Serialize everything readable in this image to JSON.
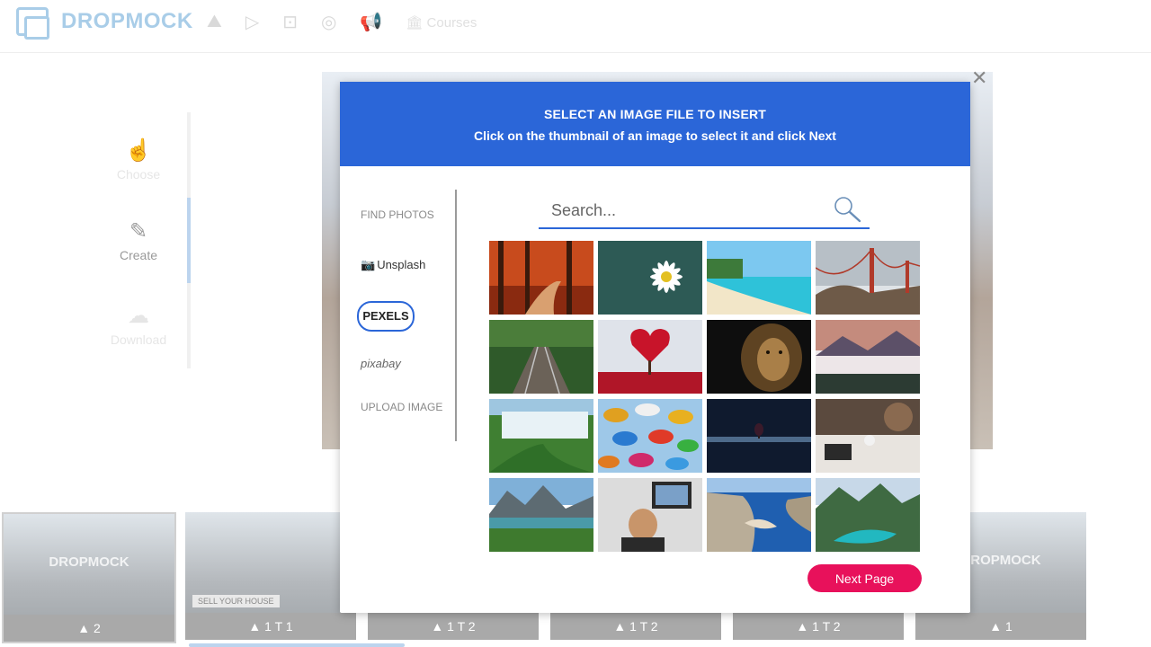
{
  "app": {
    "brand": "DROPMOCK",
    "nav": {
      "courses_label": "Courses"
    }
  },
  "steps": [
    {
      "label": "Choose"
    },
    {
      "label": "Create"
    },
    {
      "label": "Download"
    }
  ],
  "modal": {
    "title": "SELECT AN IMAGE FILE TO INSERT",
    "subtitle": "Click on the thumbnail of an image to select it and click Next",
    "sources": {
      "find_photos": "FIND PHOTOS",
      "unsplash": "Unsplash",
      "pexels": "PEXELS",
      "pixabay": "pixabay",
      "upload": "UPLOAD IMAGE",
      "selected": "PEXELS"
    },
    "search": {
      "placeholder": "Search..."
    },
    "next_label": "Next Page",
    "grid": [
      "autumn-forest-path",
      "white-daisy",
      "tropical-beach",
      "golden-gate-bridge",
      "railway-track",
      "heart-tree",
      "lion",
      "misty-mountains",
      "waterfall",
      "umbrellas",
      "hot-air-balloon",
      "meeting-laptop",
      "mountain-lake",
      "office-man",
      "navagio-beach",
      "alpine-lake"
    ]
  },
  "thumbnails": [
    {
      "caption": "▲ 2",
      "watermark": "DROPMOCK"
    },
    {
      "caption": "▲ 1   T 1",
      "badge": "SELL YOUR HOUSE"
    },
    {
      "caption": "▲ 1   T 2"
    },
    {
      "caption": "▲ 1   T 2"
    },
    {
      "caption": "▲ 1   T 2"
    },
    {
      "caption": "▲ 1",
      "watermark": "DROPMOCK"
    }
  ]
}
